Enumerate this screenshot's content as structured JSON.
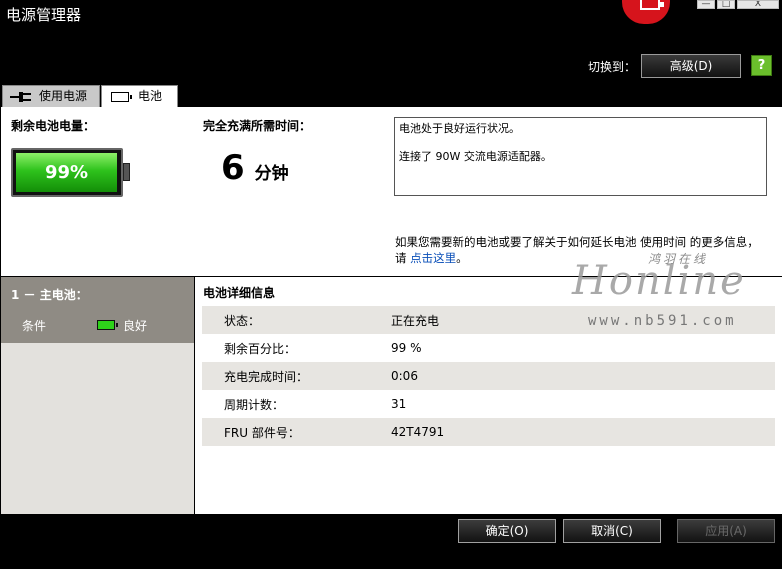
{
  "window": {
    "title": "电源管理器",
    "minimize": "—",
    "maximize": "□",
    "close": "X"
  },
  "switch": {
    "label": "切换到：",
    "button": "高级(D)",
    "help": "?"
  },
  "tabs": [
    {
      "label": "使用电源",
      "icon": "plug-icon",
      "active": false
    },
    {
      "label": "电池",
      "icon": "battery-icon",
      "active": true
    }
  ],
  "summary": {
    "remaining_label": "剩余电池电量：",
    "remaining_percent": "99%",
    "remaining_level": 0.99,
    "charge_label": "完全充满所需时间：",
    "charge_value": "6",
    "charge_unit": "分钟",
    "status_line1": "电池处于良好运行状况。",
    "status_line2": "连接了 90W 交流电源适配器。",
    "more_info_text": "如果您需要新的电池或要了解关于如何延长电池 使用时间 的更多信息，请 ",
    "more_info_link": "点击这里",
    "more_info_end": "。"
  },
  "battery_list": {
    "header": "1 － 主电池：",
    "condition_label": "条件",
    "condition_value": "良好"
  },
  "details": {
    "title": "电池详细信息",
    "rows": [
      {
        "key": "状态：",
        "value": "正在充电"
      },
      {
        "key": "剩余百分比：",
        "value": "99 %"
      },
      {
        "key": "充电完成时间：",
        "value": "0:06"
      },
      {
        "key": "周期计数：",
        "value": "31"
      },
      {
        "key": "FRU 部件号：",
        "value": "42T4791"
      }
    ]
  },
  "footer": {
    "ok": "确定(O)",
    "cancel": "取消(C)",
    "apply": "应用(A)"
  },
  "watermark": {
    "script": "鸿羽在线",
    "logo": "Honline",
    "url": "www.nb591.com"
  },
  "colors": {
    "battery_green": "#2ec21c",
    "link_blue": "#0a4fb8",
    "logo_red": "#d6141c"
  }
}
